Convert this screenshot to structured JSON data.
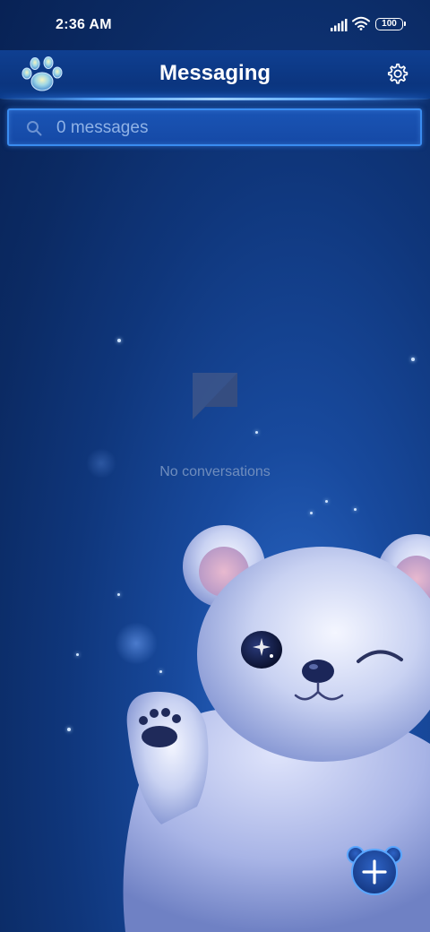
{
  "status_bar": {
    "time": "2:36 AM",
    "battery": "100"
  },
  "header": {
    "title": "Messaging",
    "logo_icon": "paw-icon",
    "settings_icon": "gear-icon"
  },
  "search": {
    "placeholder": "0 messages",
    "icon": "search-icon"
  },
  "empty_state": {
    "icon": "message-bubble-icon",
    "text": "No conversations"
  },
  "fab": {
    "icon": "plus-icon"
  },
  "colors": {
    "background": "#0b2a63",
    "accent": "#3a8cf0",
    "text_muted": "#6f8dbd"
  }
}
